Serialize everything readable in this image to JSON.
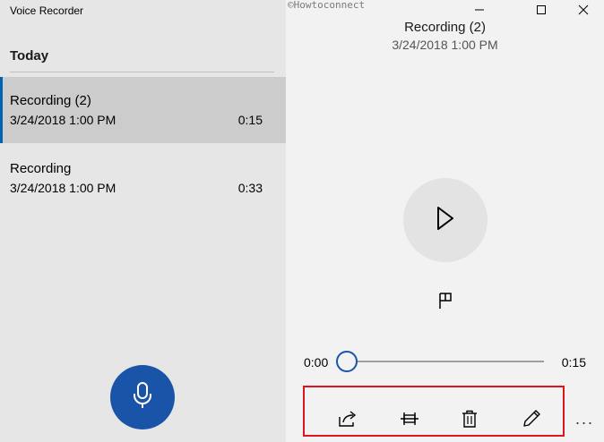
{
  "app": {
    "title": "Voice Recorder"
  },
  "list": {
    "section": "Today",
    "items": [
      {
        "name": "Recording (2)",
        "date": "3/24/2018 1:00 PM",
        "duration": "0:15",
        "selected": true
      },
      {
        "name": "Recording",
        "date": "3/24/2018 1:00 PM",
        "duration": "0:33",
        "selected": false
      }
    ]
  },
  "record_button": {
    "icon": "microphone-icon",
    "color": "#1a54a8"
  },
  "watermark": "©Howtoconnect",
  "window_controls": {
    "minimize_icon": "minimize-icon",
    "maximize_icon": "maximize-icon",
    "close_icon": "close-icon"
  },
  "player": {
    "title": "Recording (2)",
    "date": "3/24/2018 1:00 PM",
    "play_icon": "play-icon",
    "marker_icon": "flag-icon",
    "time_current": "0:00",
    "time_total": "0:15",
    "progress": 0
  },
  "toolbar": {
    "icons": [
      "share-icon",
      "trim-icon",
      "delete-icon",
      "rename-icon"
    ],
    "more_label": "···"
  },
  "colors": {
    "accent": "#0063b1",
    "highlight": "#e0141e",
    "selected_bg": "#cccccc"
  }
}
